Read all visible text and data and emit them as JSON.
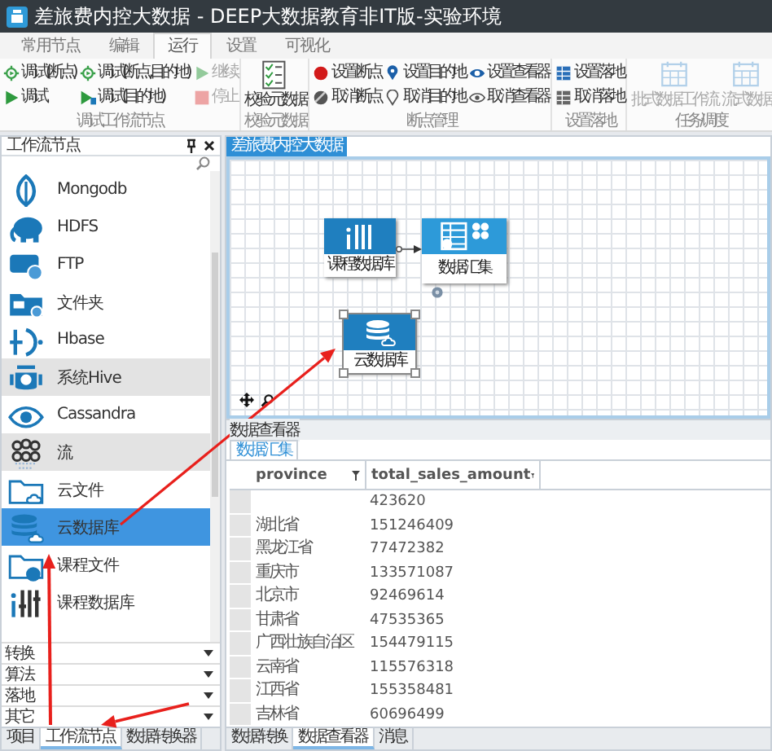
{
  "window": {
    "title": "差旅费内控大数据 - DEEP大数据教育非IT版-实验环境"
  },
  "menu_tabs": [
    {
      "label": "常用节点",
      "selected": false
    },
    {
      "label": "编辑",
      "selected": false
    },
    {
      "label": "运行",
      "selected": true
    },
    {
      "label": "设置",
      "selected": false
    },
    {
      "label": "可视化",
      "selected": false
    }
  ],
  "ribbon_groups": [
    {
      "label": "调试工作流节点",
      "columns": [
        [
          {
            "label": "调试(断点)",
            "kind": "gear",
            "disabled": false
          },
          {
            "label": "调试",
            "kind": "play",
            "disabled": false
          }
        ],
        [
          {
            "label": "调试(断点,目的地)",
            "kind": "gear",
            "disabled": false
          },
          {
            "label": "调试(目的地)",
            "kind": "play-flag",
            "disabled": false
          }
        ],
        [
          {
            "label": "继续",
            "kind": "play",
            "disabled": true
          },
          {
            "label": "停止",
            "kind": "stop",
            "disabled": true
          }
        ]
      ]
    },
    {
      "label": "校验元数据",
      "columns": [
        [
          {
            "label": "校验元数据",
            "kind": "checklist",
            "disabled": false
          }
        ]
      ]
    },
    {
      "label": "断点管理",
      "columns": [
        [
          {
            "label": "设置断点",
            "kind": "dot",
            "disabled": false
          },
          {
            "label": "取消断点",
            "kind": "dot-off",
            "disabled": false
          }
        ],
        [
          {
            "label": "设置目的地",
            "kind": "pin",
            "disabled": false
          },
          {
            "label": "取消目的地",
            "kind": "pin-off",
            "disabled": false
          }
        ],
        [
          {
            "label": "设置查看器",
            "kind": "eye",
            "disabled": false
          },
          {
            "label": "取消查看器",
            "kind": "eye-off",
            "disabled": false
          }
        ]
      ]
    },
    {
      "label": "设置落地",
      "columns": [
        [
          {
            "label": "设置落地",
            "kind": "table",
            "disabled": false
          },
          {
            "label": "取消落地",
            "kind": "table-off",
            "disabled": false
          }
        ]
      ]
    },
    {
      "label": "任务/调度",
      "columns": [
        [
          {
            "label": "批式数据工作流",
            "kind": "grid",
            "disabled": true
          }
        ],
        [
          {
            "label": "流式数据",
            "kind": "grid",
            "disabled": true
          }
        ]
      ]
    }
  ],
  "left_panel": {
    "title": "工作流节点",
    "items": [
      {
        "label": "Mongodb",
        "kind": "mongodb",
        "selected": false,
        "highlighted": false
      },
      {
        "label": "HDFS",
        "kind": "hdfs",
        "selected": false,
        "highlighted": false
      },
      {
        "label": "FTP",
        "kind": "ftp",
        "selected": false,
        "highlighted": false
      },
      {
        "label": "文件夹",
        "kind": "folder",
        "selected": false,
        "highlighted": false
      },
      {
        "label": "Hbase",
        "kind": "hbase",
        "selected": false,
        "highlighted": false
      },
      {
        "label": "系统Hive",
        "kind": "hive",
        "selected": false,
        "highlighted": true
      },
      {
        "label": "Cassandra",
        "kind": "cassandra",
        "selected": false,
        "highlighted": false
      },
      {
        "label": "流",
        "kind": "stream",
        "selected": false,
        "highlighted": true
      },
      {
        "label": "云文件",
        "kind": "cloud-file",
        "selected": false,
        "highlighted": false
      },
      {
        "label": "云数据库",
        "kind": "cloud-db",
        "selected": true,
        "highlighted": false
      },
      {
        "label": "课程文件",
        "kind": "course-file",
        "selected": false,
        "highlighted": false
      },
      {
        "label": "课程数据库",
        "kind": "course-db",
        "selected": false,
        "highlighted": false
      }
    ],
    "categories": [
      {
        "label": "转换",
        "expanded": false
      },
      {
        "label": "算法",
        "expanded": false
      },
      {
        "label": "落地",
        "expanded": false
      },
      {
        "label": "其它",
        "expanded": false
      }
    ],
    "tabs": [
      {
        "label": "项目",
        "selected": false
      },
      {
        "label": "工作流节点",
        "selected": true
      },
      {
        "label": "数据转换器",
        "selected": false
      }
    ]
  },
  "document_tab": {
    "label": "差旅费内控大数据"
  },
  "canvas": {
    "nodes": [
      {
        "label": "课程数据库",
        "kind": "course-db",
        "selected": false,
        "links_to_next": true
      },
      {
        "label": "数据汇集",
        "kind": "aggregate",
        "selected": false,
        "links_to_next": false
      },
      {
        "label": "云数据库",
        "kind": "cloud-db",
        "selected": true,
        "links_to_next": false
      }
    ]
  },
  "viewer": {
    "title": "数据查看器",
    "tabs": [
      {
        "label": "数据汇集",
        "selected": true
      }
    ],
    "columns": [
      "province",
      "total_sales_amount"
    ],
    "rows": [
      [
        null,
        "423620"
      ],
      [
        "湖北省",
        "151246409"
      ],
      [
        "黑龙江省",
        "77472382"
      ],
      [
        "重庆市",
        "133571087"
      ],
      [
        "北京市",
        "92469614"
      ],
      [
        "甘肃省",
        "47535365"
      ],
      [
        "广西壮族自治区",
        "154479115"
      ],
      [
        "云南省",
        "115576318"
      ],
      [
        "江西省",
        "155358481"
      ],
      [
        "吉林省",
        "60696499"
      ]
    ]
  },
  "bottom_tabs": [
    {
      "label": "数据转换",
      "selected": false
    },
    {
      "label": "数据查看器",
      "selected": true
    },
    {
      "label": "消息",
      "selected": false
    }
  ]
}
